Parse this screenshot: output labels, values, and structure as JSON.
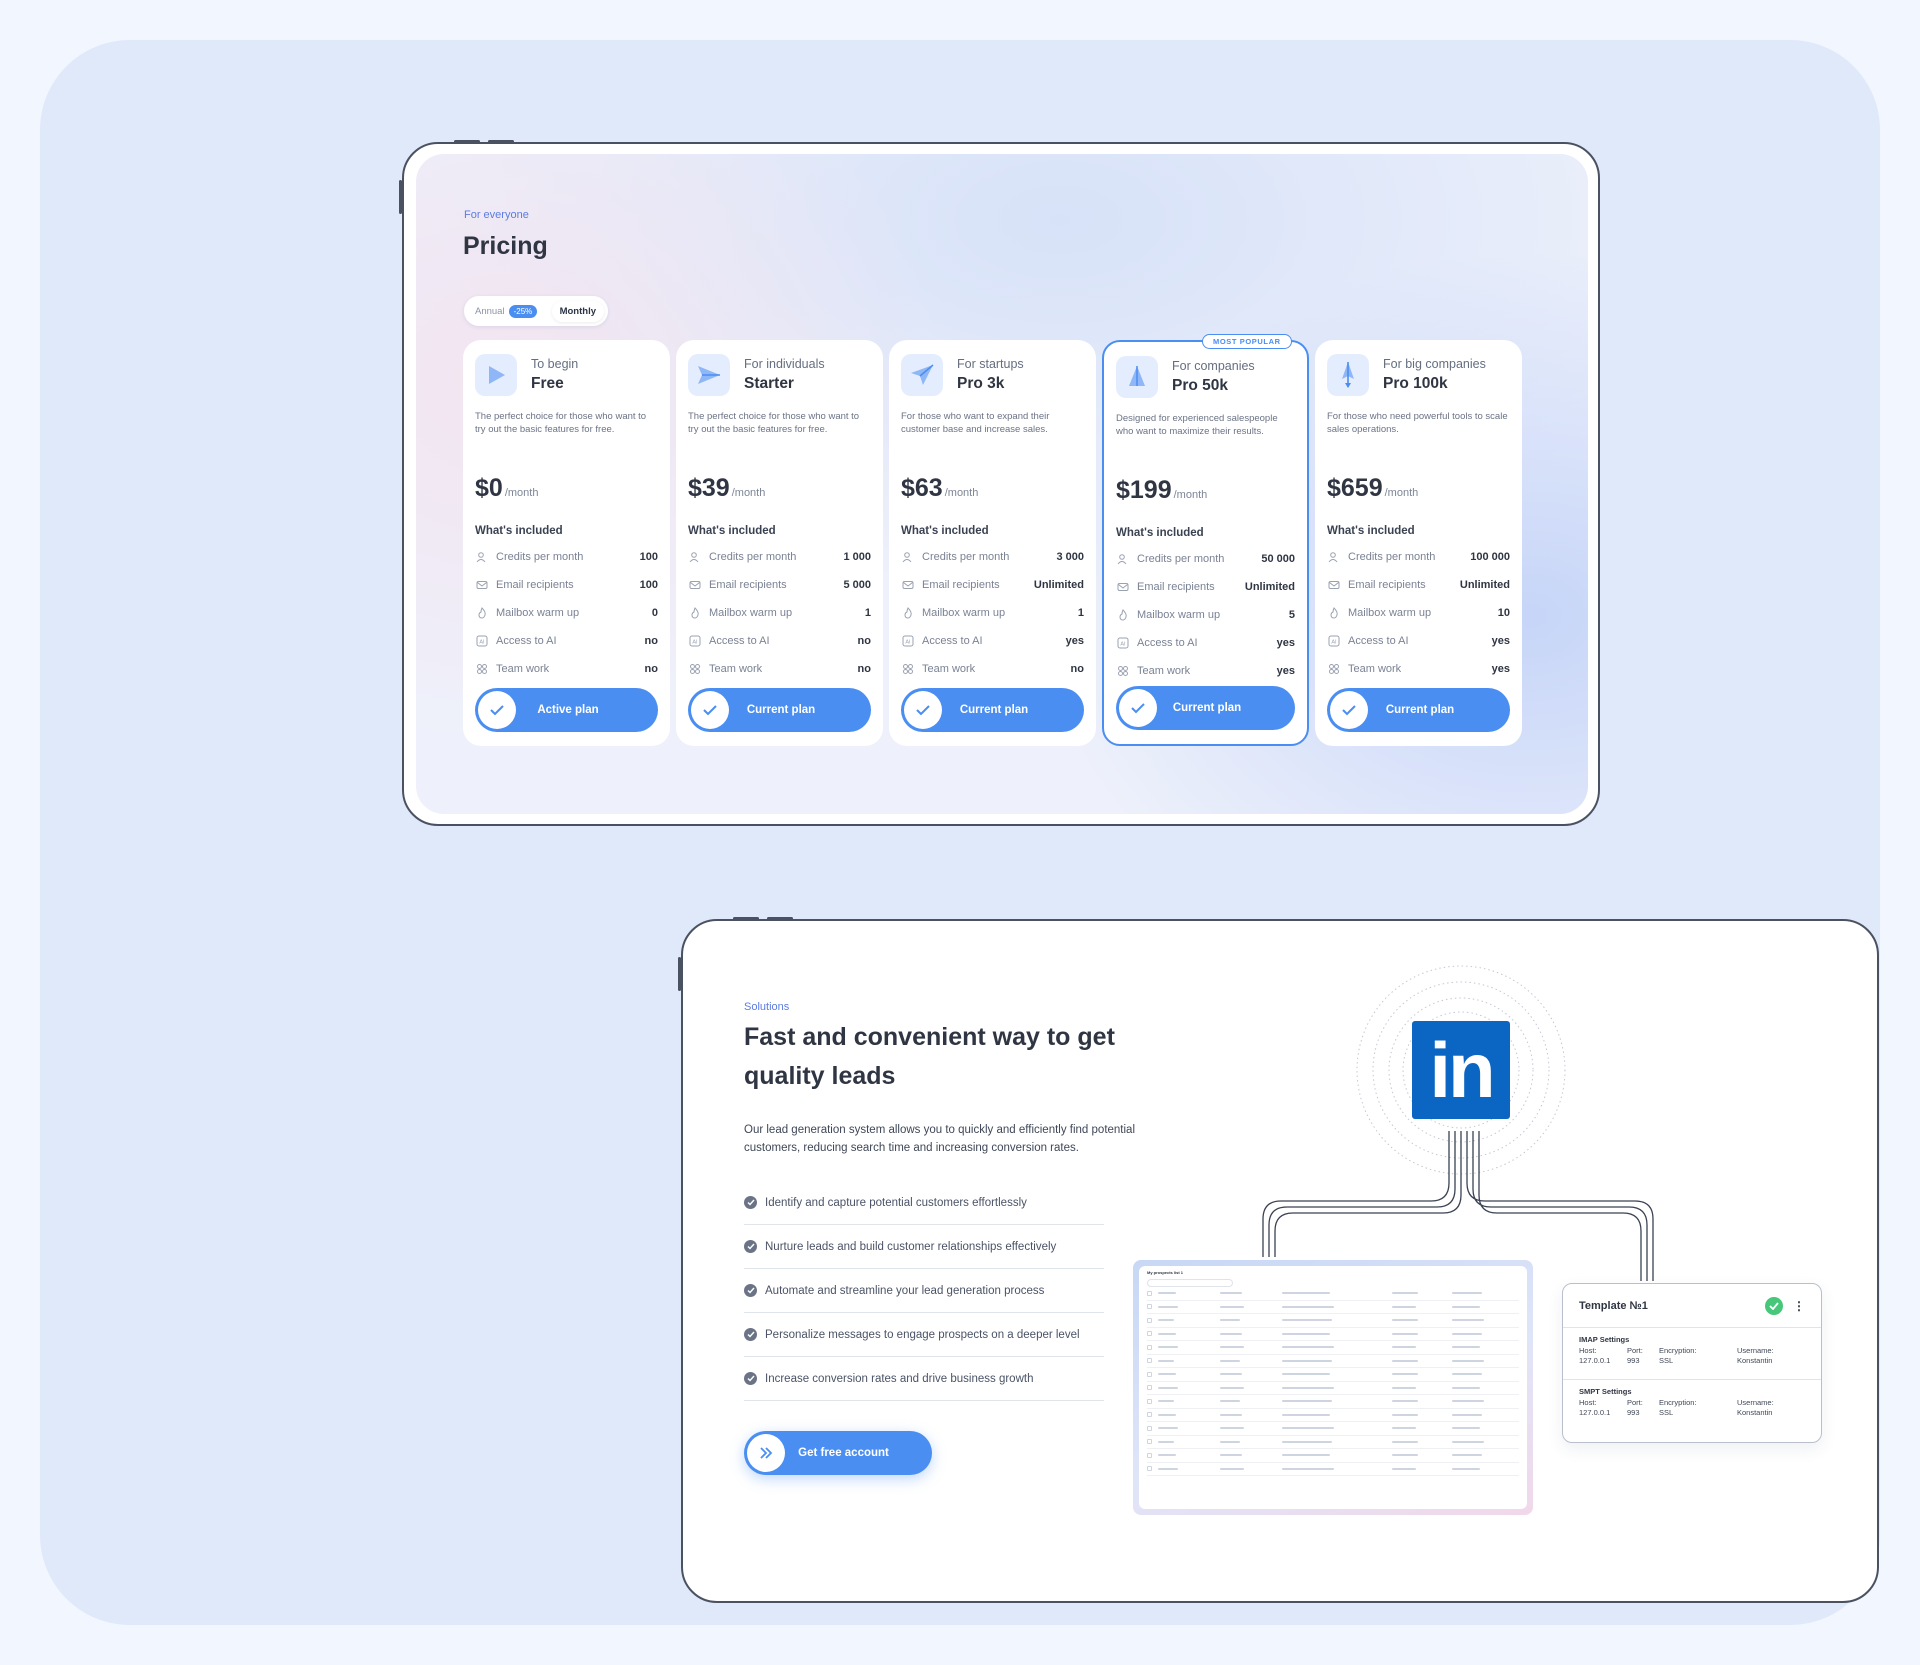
{
  "pricing": {
    "eyebrow": "For everyone",
    "title": "Pricing",
    "toggle": {
      "annual": "Annual",
      "discount": "-25%",
      "monthly": "Monthly"
    },
    "included_label": "What's included",
    "per_label": "/month",
    "plans": [
      {
        "tier": "To begin",
        "name": "Free",
        "desc": "The perfect choice for those who want to try out the basic features for free.",
        "price": "$0",
        "icon": "play-icon",
        "features": [
          {
            "label": "Credits per month",
            "value": "100",
            "icon": "users-icon"
          },
          {
            "label": "Email recipients",
            "value": "100",
            "icon": "mail-icon"
          },
          {
            "label": "Mailbox warm up",
            "value": "0",
            "icon": "flame-icon"
          },
          {
            "label": "Access to AI",
            "value": "no",
            "icon": "ai-icon"
          },
          {
            "label": "Team work",
            "value": "no",
            "icon": "grid-icon"
          }
        ],
        "button": "Active plan"
      },
      {
        "tier": "For individuals",
        "name": "Starter",
        "desc": "The perfect choice for those who want to try out the basic features for free.",
        "price": "$39",
        "icon": "send-icon",
        "features": [
          {
            "label": "Credits per month",
            "value": "1 000",
            "icon": "users-icon"
          },
          {
            "label": "Email recipients",
            "value": "5 000",
            "icon": "mail-icon"
          },
          {
            "label": "Mailbox warm up",
            "value": "1",
            "icon": "flame-icon"
          },
          {
            "label": "Access to AI",
            "value": "no",
            "icon": "ai-icon"
          },
          {
            "label": "Team work",
            "value": "no",
            "icon": "grid-icon"
          }
        ],
        "button": "Current plan"
      },
      {
        "tier": "For startups",
        "name": "Pro 3k",
        "desc": "For those who want to expand their customer base and increase sales.",
        "price": "$63",
        "icon": "paper-plane-icon",
        "features": [
          {
            "label": "Credits per month",
            "value": "3 000",
            "icon": "users-icon"
          },
          {
            "label": "Email recipients",
            "value": "Unlimited",
            "icon": "mail-icon"
          },
          {
            "label": "Mailbox warm up",
            "value": "1",
            "icon": "flame-icon"
          },
          {
            "label": "Access to AI",
            "value": "yes",
            "icon": "ai-icon"
          },
          {
            "label": "Team work",
            "value": "no",
            "icon": "grid-icon"
          }
        ],
        "button": "Current plan"
      },
      {
        "tier": "For companies",
        "name": "Pro 50k",
        "desc": "Designed for experienced salespeople who want to maximize their results.",
        "price": "$199",
        "icon": "sail-icon",
        "badge": "MOST POPULAR",
        "features": [
          {
            "label": "Credits per month",
            "value": "50 000",
            "icon": "users-icon"
          },
          {
            "label": "Email recipients",
            "value": "Unlimited",
            "icon": "mail-icon"
          },
          {
            "label": "Mailbox warm up",
            "value": "5",
            "icon": "flame-icon"
          },
          {
            "label": "Access to AI",
            "value": "yes",
            "icon": "ai-icon"
          },
          {
            "label": "Team work",
            "value": "yes",
            "icon": "grid-icon"
          }
        ],
        "button": "Current plan"
      },
      {
        "tier": "For big companies",
        "name": "Pro 100k",
        "desc": "For those who need powerful tools to scale sales operations.",
        "price": "$659",
        "icon": "rocket-icon",
        "features": [
          {
            "label": "Credits per month",
            "value": "100 000",
            "icon": "users-icon"
          },
          {
            "label": "Email recipients",
            "value": "Unlimited",
            "icon": "mail-icon"
          },
          {
            "label": "Mailbox warm up",
            "value": "10",
            "icon": "flame-icon"
          },
          {
            "label": "Access to AI",
            "value": "yes",
            "icon": "ai-icon"
          },
          {
            "label": "Team work",
            "value": "yes",
            "icon": "grid-icon"
          }
        ],
        "button": "Current plan"
      }
    ]
  },
  "solutions": {
    "eyebrow": "Solutions",
    "title_line1": "Fast and convenient way to get",
    "title_line2": "quality leads",
    "subtitle": "Our lead generation system allows you to quickly and efficiently find potential customers, reducing search time and increasing conversion rates.",
    "bullets": [
      "Identify and capture potential customers effortlessly",
      "Nurture leads and build customer relationships effectively",
      "Automate and streamline your lead generation process",
      "Personalize messages to engage prospects on a deeper level",
      "Increase conversion rates and drive business growth"
    ],
    "cta": "Get free account",
    "linkedin_logo": "in",
    "app_title": "My prospects list 1",
    "template": {
      "title": "Template №1",
      "sections": [
        {
          "heading": "IMAP Settings",
          "host_label": "Host:",
          "host": "127.0.0.1",
          "port_label": "Port:",
          "port": "993",
          "enc_label": "Encryption:",
          "enc": "SSL",
          "user_label": "Username:",
          "user": "Konstantin"
        },
        {
          "heading": "SMPT Settings",
          "host_label": "Host:",
          "host": "127.0.0.1",
          "port_label": "Port:",
          "port": "993",
          "enc_label": "Encryption:",
          "enc": "SSL",
          "user_label": "Username:",
          "user": "Konstantin"
        }
      ]
    }
  },
  "colors": {
    "accent": "#4a8ef2",
    "linkedin": "#0a66c2",
    "success": "#46c77a",
    "outer_bg": "#dfe9fa"
  }
}
